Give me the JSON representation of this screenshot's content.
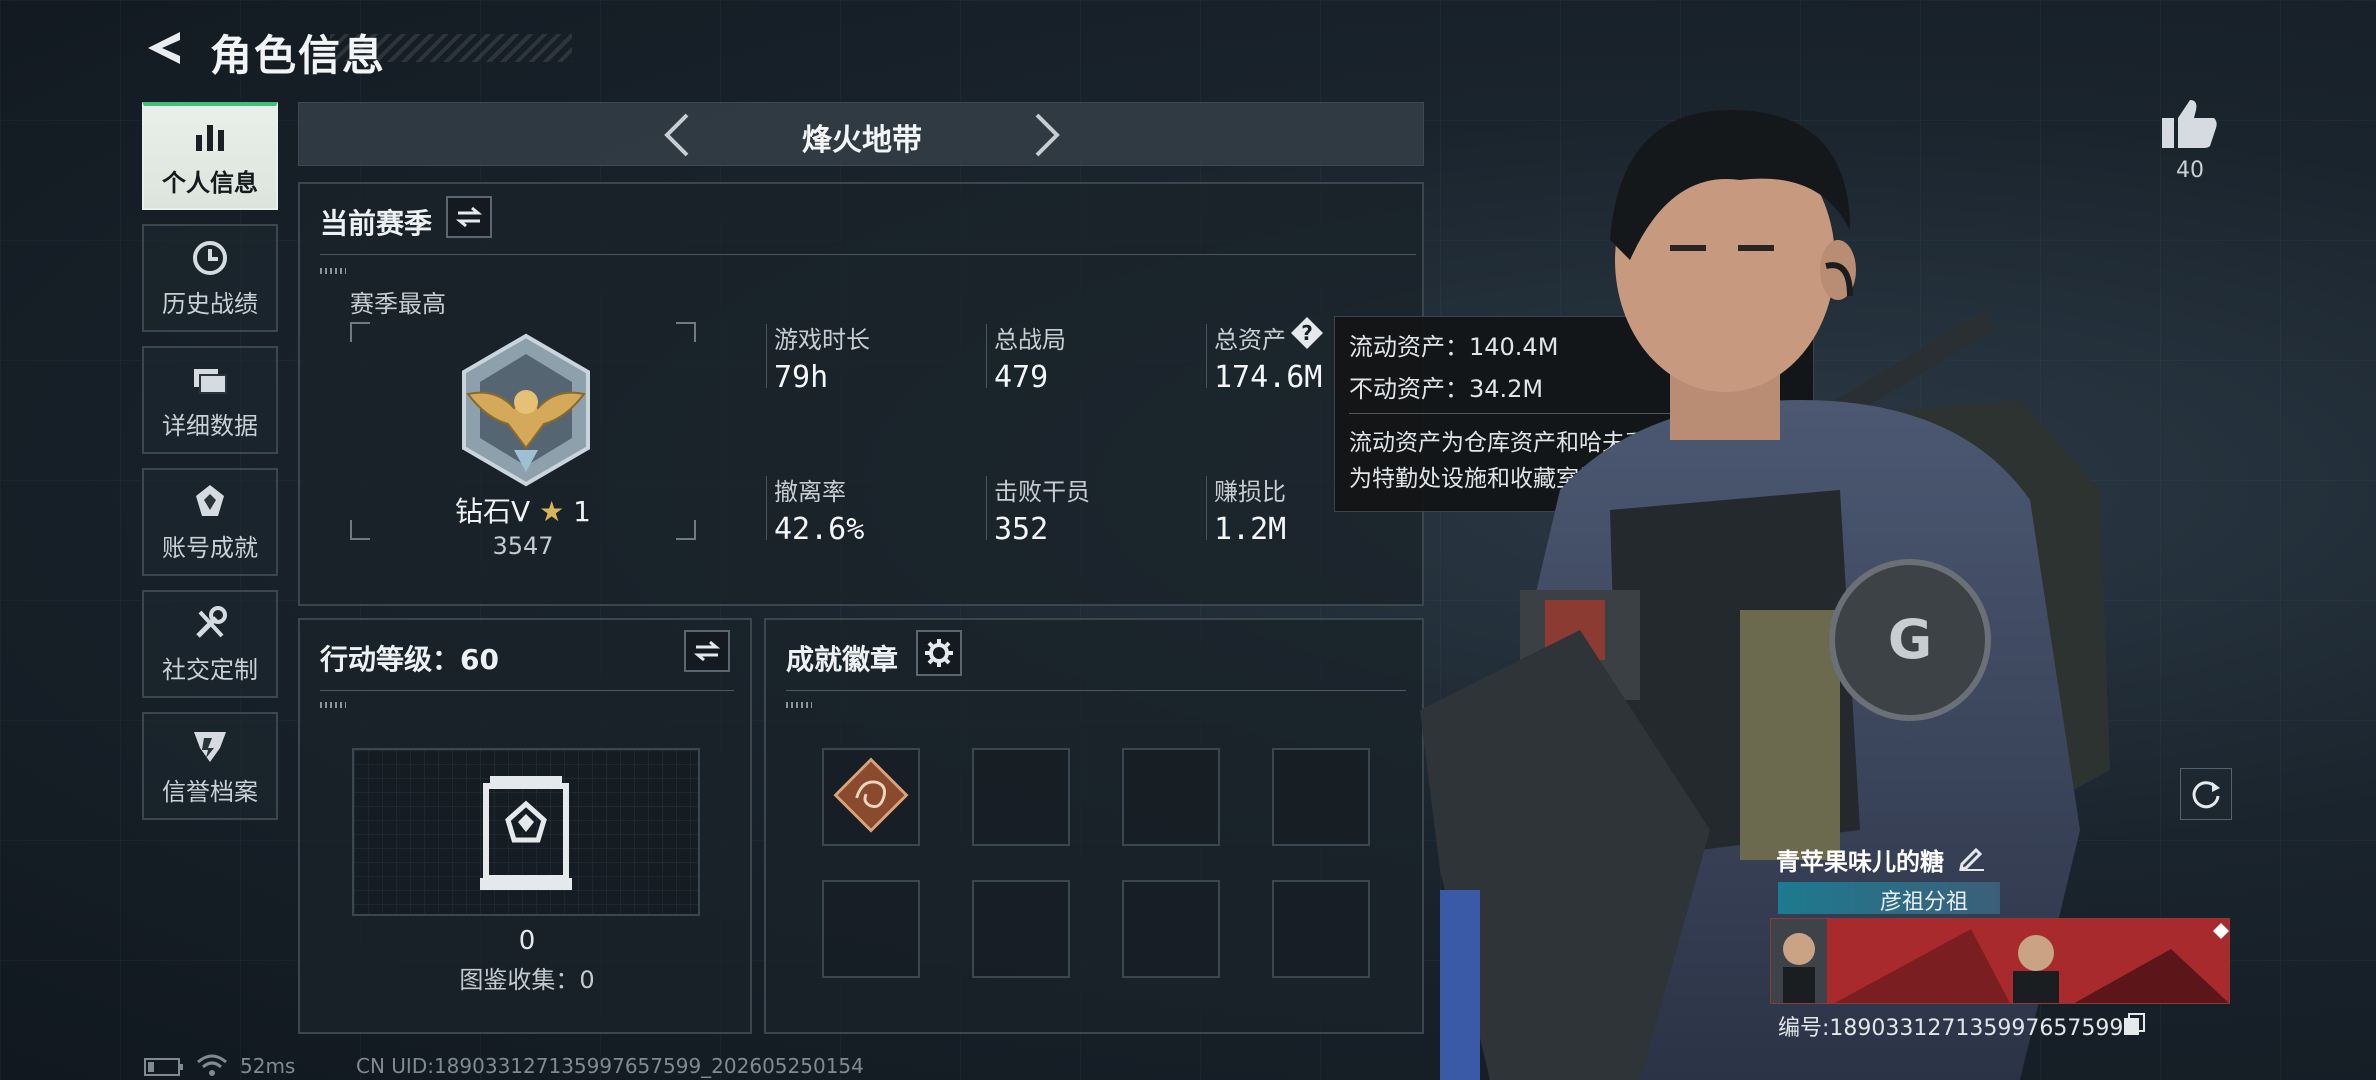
{
  "header": {
    "title": "角色信息"
  },
  "sidebar": {
    "items": [
      {
        "label": "个人信息",
        "icon": "bar-chart-icon",
        "active": true
      },
      {
        "label": "历史战绩",
        "icon": "clock-icon"
      },
      {
        "label": "详细数据",
        "icon": "folder-icon"
      },
      {
        "label": "账号成就",
        "icon": "achievement-icon"
      },
      {
        "label": "社交定制",
        "icon": "wrench-icon"
      },
      {
        "label": "信誉档案",
        "icon": "shield-badge-icon"
      }
    ]
  },
  "mode": {
    "name": "烽火地带"
  },
  "season": {
    "title": "当前赛季",
    "best_label": "赛季最高",
    "rank_name": "钻石V",
    "rank_stars": "1",
    "rank_score": "3547",
    "stats": [
      {
        "label": "游戏时长",
        "value": "79h"
      },
      {
        "label": "总战局",
        "value": "479"
      },
      {
        "label": "总资产",
        "value": "174.6M"
      },
      {
        "label": "撤离率",
        "value": "42.6%"
      },
      {
        "label": "击败干员",
        "value": "352"
      },
      {
        "label": "赚损比",
        "value": "1.2M"
      }
    ]
  },
  "tooltip": {
    "liquid": "流动资产：140.4M",
    "fixed": "不动资产：34.2M",
    "note_line1": "流动资产为仓库资产和哈夫币，不动资产",
    "note_line2": "为特勤处设施和收藏室设施"
  },
  "level": {
    "title": "行动等级：60",
    "count": "0",
    "codex_label": "图鉴收集：0"
  },
  "achievements": {
    "title": "成就徽章"
  },
  "status_bar": {
    "ping": "52ms",
    "uid": "CN UID:18903312713599765759­9_202605250154"
  },
  "character": {
    "likes": "40"
  },
  "player": {
    "name": "青苹果味儿的糖",
    "guild": "彦祖分祖",
    "id": "编号:18903312713599765759­9"
  },
  "colors": {
    "accent_green": "#3fbf7a",
    "banner_red": "#a82a2d",
    "guild_teal": "#1d7a8f"
  }
}
